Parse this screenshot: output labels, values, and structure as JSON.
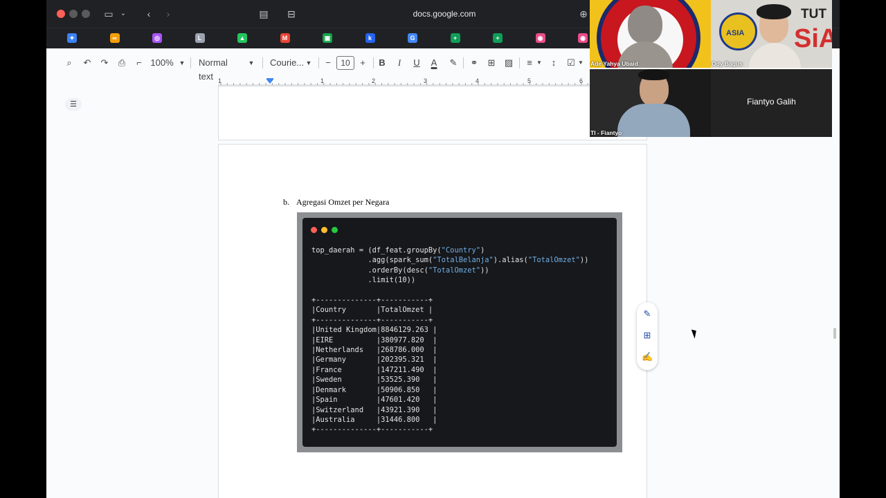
{
  "browser": {
    "url": "docs.google.com",
    "colors": {
      "close": "#ff5f57",
      "minimize": "#febc2e",
      "maximize": "#28c840"
    }
  },
  "bookmarks": [
    {
      "icon": "gemini-icon",
      "glyph": "✦",
      "color": "#3b82f6"
    },
    {
      "icon": "infinity-icon",
      "glyph": "∞",
      "color": "#f59e0b"
    },
    {
      "icon": "app-icon",
      "glyph": "◎",
      "color": "#a855f7"
    },
    {
      "icon": "letter-l-icon",
      "glyph": "L",
      "color": "#9ca3af"
    },
    {
      "icon": "drive-icon",
      "glyph": "▲",
      "color": "#22c55e"
    },
    {
      "icon": "gmail-icon",
      "glyph": "M",
      "color": "#ea4335"
    },
    {
      "icon": "folder-icon",
      "glyph": "▣",
      "color": "#16a34a"
    },
    {
      "icon": "letter-k-icon",
      "glyph": "k",
      "color": "#2563eb"
    },
    {
      "icon": "google-icon",
      "glyph": "G",
      "color": "#4285f4"
    },
    {
      "icon": "sheets-icon",
      "glyph": "+",
      "color": "#0f9d58"
    },
    {
      "icon": "sheets-icon-2",
      "glyph": "+",
      "color": "#0f9d58"
    },
    {
      "icon": "dribbble-icon",
      "glyph": "◉",
      "color": "#ea4c89"
    },
    {
      "icon": "dribbble-icon-2",
      "glyph": "◉",
      "color": "#ea4c89"
    }
  ],
  "toolbar": {
    "zoom": "100%",
    "style": "Normal text",
    "font": "Courie...",
    "font_size": "10",
    "bold": "B",
    "italic": "I",
    "underline": "U",
    "text_color": "A"
  },
  "ruler": [
    "1",
    "1",
    "2",
    "3",
    "4",
    "5",
    "6"
  ],
  "document": {
    "list_letter": "b.",
    "heading": "Agregasi Omzet per Negara",
    "code": [
      [
        [
          "top_daerah = (df_feat.groupBy(",
          ""
        ],
        [
          "\"Country\"",
          "str"
        ],
        [
          ")",
          ""
        ]
      ],
      [
        [
          "             .agg(spark_sum(",
          ""
        ],
        [
          "\"TotalBelanja\"",
          "str"
        ],
        [
          ").alias(",
          ""
        ],
        [
          "\"TotalOmzet\"",
          "str"
        ],
        [
          "))",
          ""
        ]
      ],
      [
        [
          "             .orderBy(desc(",
          ""
        ],
        [
          "\"TotalOmzet\"",
          "str"
        ],
        [
          "))",
          ""
        ]
      ],
      [
        [
          "             .limit(10))",
          ""
        ]
      ],
      [
        [
          "",
          ""
        ]
      ],
      [
        [
          "+--------------+-----------+",
          ""
        ]
      ],
      [
        [
          "|Country       |TotalOmzet |",
          ""
        ]
      ],
      [
        [
          "+--------------+-----------+",
          ""
        ]
      ],
      [
        [
          "|United Kingdom|8846129.263 |",
          ""
        ]
      ],
      [
        [
          "|EIRE          |380977.820  |",
          ""
        ]
      ],
      [
        [
          "|Netherlands   |268786.000  |",
          ""
        ]
      ],
      [
        [
          "|Germany       |202395.321  |",
          ""
        ]
      ],
      [
        [
          "|France        |147211.490  |",
          ""
        ]
      ],
      [
        [
          "|Sweden        |53525.390   |",
          ""
        ]
      ],
      [
        [
          "|Denmark       |50906.850   |",
          ""
        ]
      ],
      [
        [
          "|Spain         |47601.420   |",
          ""
        ]
      ],
      [
        [
          "|Switzerland   |43921.390   |",
          ""
        ]
      ],
      [
        [
          "|Australia     |31446.800   |",
          ""
        ]
      ],
      [
        [
          "+--------------+-----------+",
          ""
        ]
      ]
    ]
  },
  "meeting": {
    "participants": [
      {
        "name": "Ade Yahya Ubaid"
      },
      {
        "name": "Ody Bagus"
      },
      {
        "name": "TI - Fiantyo"
      },
      {
        "name": "Fiantyo Galih"
      }
    ],
    "logo_text_1": "ASIA",
    "logo_text_2": "TUT",
    "logo_text_3": "SiA"
  }
}
